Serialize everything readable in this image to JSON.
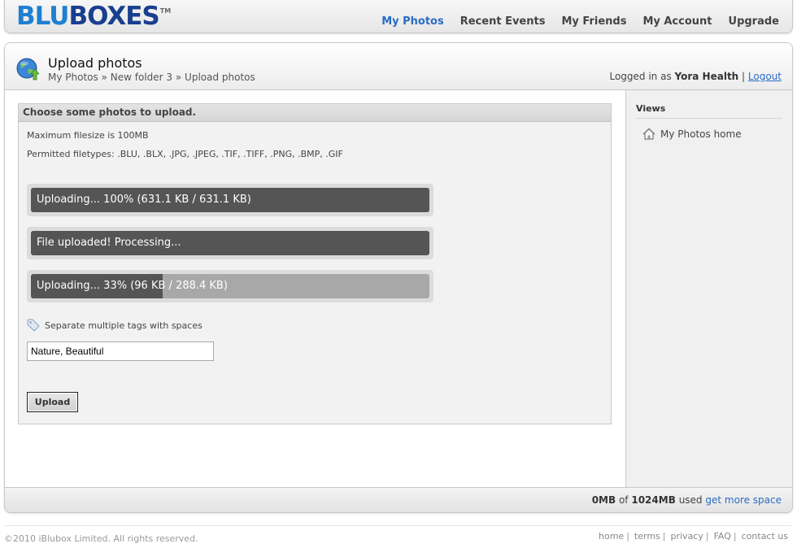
{
  "logo": {
    "blu": "BLU",
    "boxes": "BOXES",
    "tm": "TM"
  },
  "nav": {
    "items": [
      {
        "label": "My Photos",
        "active": true
      },
      {
        "label": "Recent Events",
        "active": false
      },
      {
        "label": "My Friends",
        "active": false
      },
      {
        "label": "My Account",
        "active": false
      },
      {
        "label": "Upgrade",
        "active": false
      }
    ]
  },
  "header": {
    "title": "Upload photos",
    "breadcrumb": [
      "My Photos",
      "New folder 3",
      "Upload photos"
    ],
    "breadcrumb_separator": "»",
    "logged_in_prefix": "Logged in as",
    "user_name": "Yora Health",
    "logout_label": "Logout"
  },
  "upload": {
    "panel_title": "Choose some photos to upload.",
    "max_filesize": "Maximum filesize is 100MB",
    "permitted_types": "Permitted filetypes: .BLU, .BLX, .JPG, .JPEG, .TIF, .TIFF, .PNG, .BMP, .GIF",
    "progress": [
      {
        "label": "Uploading... 100% (631.1 KB / 631.1 KB)",
        "fraction": 1.0
      },
      {
        "label": "File uploaded! Processing...",
        "fraction": 1.0
      },
      {
        "label": "Uploading... 33% (96 KB / 288.4 KB)",
        "fraction": 0.33
      }
    ],
    "tags_hint": "Separate multiple tags with spaces",
    "tags_value": "Nature, Beautiful",
    "upload_button": "Upload"
  },
  "sidebar": {
    "title": "Views",
    "items": [
      {
        "label": "My Photos home",
        "icon": "home-icon"
      }
    ]
  },
  "storage": {
    "used": "0MB",
    "of": "of",
    "total": "1024MB",
    "used_label": "used",
    "more_link": "get more space"
  },
  "footer": {
    "copyright": "©2010 iBlubox Limited. All rights reserved.",
    "links": [
      "home",
      "terms",
      "privacy",
      "FAQ",
      "contact us"
    ]
  },
  "colors": {
    "accent": "#2a6cc2",
    "logo_light": "#1f7fd1",
    "logo_dark": "#1a3f8f",
    "progress_fill": "#555555"
  }
}
